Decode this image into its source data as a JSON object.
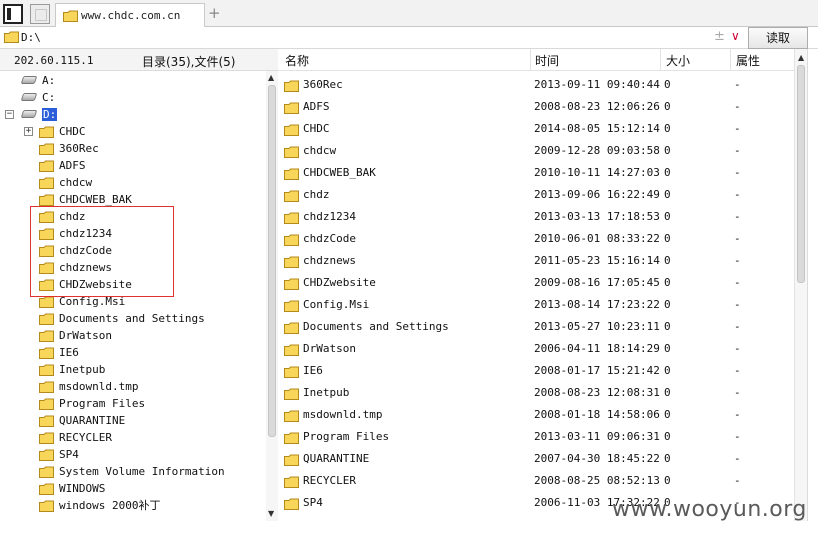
{
  "tabbar": {
    "tab_title": "www.chdc.com.cn",
    "add_tab_label": "+"
  },
  "address": {
    "path": "D:\\",
    "plus_label": "±",
    "dropdown_label": "∨",
    "read_button": "读取"
  },
  "status": {
    "ip": "202.60.115.1",
    "counts": "目录(35),文件(5)"
  },
  "tree": {
    "drives": [
      {
        "label": "A:",
        "expanded": false
      },
      {
        "label": "C:",
        "expanded": false
      },
      {
        "label": "D:",
        "expanded": true,
        "selected": true
      }
    ],
    "folders": [
      {
        "label": "CHDC",
        "has_children": true
      },
      {
        "label": "360Rec"
      },
      {
        "label": "ADFS"
      },
      {
        "label": "chdcw"
      },
      {
        "label": "CHDCWEB_BAK"
      },
      {
        "label": "chdz"
      },
      {
        "label": "chdz1234"
      },
      {
        "label": "chdzCode"
      },
      {
        "label": "chdznews"
      },
      {
        "label": "CHDZwebsite"
      },
      {
        "label": "Config.Msi"
      },
      {
        "label": "Documents and Settings"
      },
      {
        "label": "DrWatson"
      },
      {
        "label": "IE6"
      },
      {
        "label": "Inetpub"
      },
      {
        "label": "msdownld.tmp"
      },
      {
        "label": "Program Files"
      },
      {
        "label": "QUARANTINE"
      },
      {
        "label": "RECYCLER"
      },
      {
        "label": "SP4"
      },
      {
        "label": "System Volume Information"
      },
      {
        "label": "WINDOWS"
      },
      {
        "label": "windows 2000补丁"
      }
    ],
    "highlighted_folders": [
      "chdz",
      "chdz1234",
      "chdzCode",
      "chdznews",
      "CHDZwebsite"
    ]
  },
  "list": {
    "columns": [
      "名称",
      "时间",
      "大小",
      "属性"
    ],
    "rows": [
      {
        "name": "360Rec",
        "time": "2013-09-11 09:40:44",
        "size": "0",
        "attr": "-"
      },
      {
        "name": "ADFS",
        "time": "2008-08-23 12:06:26",
        "size": "0",
        "attr": "-"
      },
      {
        "name": "CHDC",
        "time": "2014-08-05 15:12:14",
        "size": "0",
        "attr": "-"
      },
      {
        "name": "chdcw",
        "time": "2009-12-28 09:03:58",
        "size": "0",
        "attr": "-"
      },
      {
        "name": "CHDCWEB_BAK",
        "time": "2010-10-11 14:27:03",
        "size": "0",
        "attr": "-"
      },
      {
        "name": "chdz",
        "time": "2013-09-06 16:22:49",
        "size": "0",
        "attr": "-"
      },
      {
        "name": "chdz1234",
        "time": "2013-03-13 17:18:53",
        "size": "0",
        "attr": "-"
      },
      {
        "name": "chdzCode",
        "time": "2010-06-01 08:33:22",
        "size": "0",
        "attr": "-"
      },
      {
        "name": "chdznews",
        "time": "2011-05-23 15:16:14",
        "size": "0",
        "attr": "-"
      },
      {
        "name": "CHDZwebsite",
        "time": "2009-08-16 17:05:45",
        "size": "0",
        "attr": "-"
      },
      {
        "name": "Config.Msi",
        "time": "2013-08-14 17:23:22",
        "size": "0",
        "attr": "-"
      },
      {
        "name": "Documents and Settings",
        "time": "2013-05-27 10:23:11",
        "size": "0",
        "attr": "-"
      },
      {
        "name": "DrWatson",
        "time": "2006-04-11 18:14:29",
        "size": "0",
        "attr": "-"
      },
      {
        "name": "IE6",
        "time": "2008-01-17 15:21:42",
        "size": "0",
        "attr": "-"
      },
      {
        "name": "Inetpub",
        "time": "2008-08-23 12:08:31",
        "size": "0",
        "attr": "-"
      },
      {
        "name": "msdownld.tmp",
        "time": "2008-01-18 14:58:06",
        "size": "0",
        "attr": "-"
      },
      {
        "name": "Program Files",
        "time": "2013-03-11 09:06:31",
        "size": "0",
        "attr": "-"
      },
      {
        "name": "QUARANTINE",
        "time": "2007-04-30 18:45:22",
        "size": "0",
        "attr": "-"
      },
      {
        "name": "RECYCLER",
        "time": "2008-08-25 08:52:13",
        "size": "0",
        "attr": "-"
      },
      {
        "name": "SP4",
        "time": "2006-11-03 17:32:22",
        "size": "0",
        "attr": "-"
      }
    ]
  },
  "watermark": "www.wooyun.org",
  "colors": {
    "folder_fill": "#f7d65a",
    "folder_stroke": "#b48a1c",
    "selection": "#2b5fd9",
    "highlight_box": "#e0312f"
  }
}
